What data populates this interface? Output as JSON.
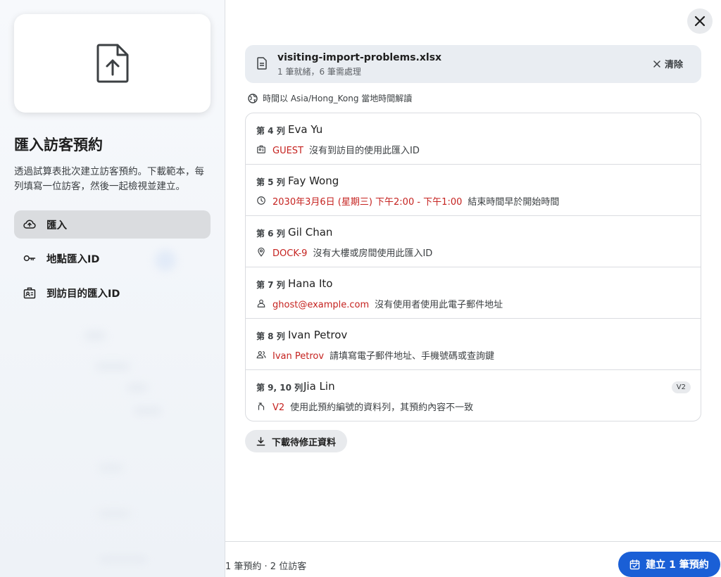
{
  "sidebar": {
    "title": "匯入訪客預約",
    "description": "透過試算表批次建立訪客預約。下載範本，每列填寫一位訪客，然後一起檢視並建立。",
    "items": [
      {
        "label": "匯入",
        "icon": "cloud-upload-icon",
        "active": true
      },
      {
        "label": "地點匯入ID",
        "icon": "key-icon",
        "active": false
      },
      {
        "label": "到訪目的匯入ID",
        "icon": "badge-icon",
        "active": false
      }
    ]
  },
  "file": {
    "name": "visiting-import-problems.xlsx",
    "status": "1 筆就緒，6 筆需處理",
    "clear_label": "清除"
  },
  "timezone_note": "時間以 Asia/Hong_Kong 當地時間解讀",
  "rows": [
    {
      "row_label": "第 4 列",
      "name": "Eva Yu",
      "icon": "badge-icon",
      "value": "GUEST",
      "message": "沒有到訪目的使用此匯入ID",
      "badge": ""
    },
    {
      "row_label": "第 5 列",
      "name": "Fay Wong",
      "icon": "clock-icon",
      "value": "2030年3月6日 (星期三) 下午2:00 - 下午1:00",
      "message": "結束時間早於開始時間",
      "badge": ""
    },
    {
      "row_label": "第 6 列",
      "name": "Gil Chan",
      "icon": "location-pin-icon",
      "value": "DOCK-9",
      "message": "沒有大樓或房間使用此匯入ID",
      "badge": ""
    },
    {
      "row_label": "第 7 列",
      "name": "Hana Ito",
      "icon": "person-icon",
      "value": "ghost@example.com",
      "message": "沒有使用者使用此電子郵件地址",
      "badge": ""
    },
    {
      "row_label": "第 8 列",
      "name": "Ivan Petrov",
      "icon": "people-icon",
      "value": "Ivan Petrov",
      "message": "請填寫電子郵件地址、手機號碼或查詢鍵",
      "badge": ""
    },
    {
      "row_label": "第 9, 10 列",
      "name": "Jia Lin",
      "icon": "merge-icon",
      "value": "V2",
      "message": "使用此預約編號的資料列，其預約內容不一致",
      "badge": "V2"
    }
  ],
  "download_label": "下載待修正資料",
  "footer": {
    "summary": "1 筆預約 · 2 位訪客",
    "create_label": "建立 1 筆預約"
  },
  "colors": {
    "error": "#c5221f",
    "primary": "#1a5fd6"
  }
}
